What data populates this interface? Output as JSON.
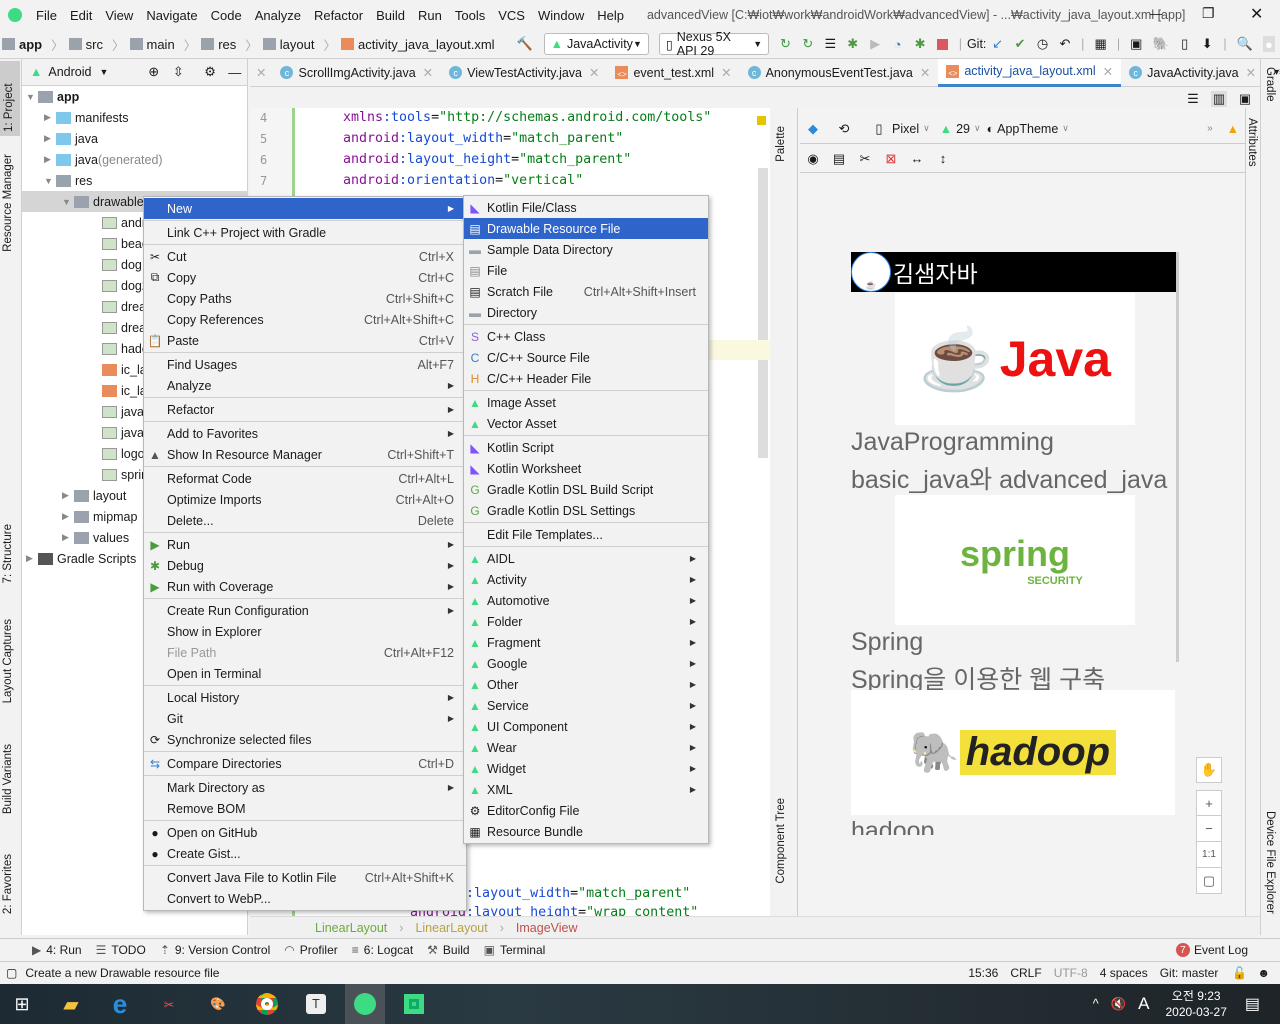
{
  "titlebar": {
    "menus": [
      "File",
      "Edit",
      "View",
      "Navigate",
      "Code",
      "Analyze",
      "Refactor",
      "Build",
      "Run",
      "Tools",
      "VCS",
      "Window",
      "Help"
    ],
    "title": "advancedView [C:₩iot₩work₩androidWork₩advancedView] - ...₩activity_java_layout.xml [app]"
  },
  "navbar": {
    "breadcrumb": [
      "app",
      "src",
      "main",
      "res",
      "layout",
      "activity_java_layout.xml"
    ],
    "run_config": "JavaActivity",
    "device": "Nexus 5X API 29",
    "git_label": "Git:"
  },
  "left_strip": {
    "project": "1: Project",
    "resource_manager": "Resource Manager",
    "structure": "7: Structure",
    "layout_captures": "Layout Captures",
    "build_variants": "Build Variants",
    "favorites": "2: Favorites"
  },
  "right_strip": {
    "gradle": "Gradle",
    "device_explorer": "Device File Explorer"
  },
  "project_panel": {
    "view_mode": "Android",
    "tree": [
      {
        "label": "app",
        "depth": 0,
        "open": true,
        "type": "module"
      },
      {
        "label": "manifests",
        "depth": 1,
        "type": "folder-blue"
      },
      {
        "label": "java",
        "depth": 1,
        "type": "folder-blue"
      },
      {
        "label": "java",
        "suffix": " (generated)",
        "depth": 1,
        "type": "folder-gen"
      },
      {
        "label": "res",
        "depth": 1,
        "open": true,
        "type": "folder-res"
      },
      {
        "label": "drawable",
        "depth": 2,
        "open": true,
        "type": "folder",
        "selected": true
      },
      {
        "label": "andro",
        "depth": 3,
        "type": "image"
      },
      {
        "label": "beach",
        "depth": 3,
        "type": "image"
      },
      {
        "label": "dog.j",
        "depth": 3,
        "type": "image"
      },
      {
        "label": "dog2",
        "depth": 3,
        "type": "image"
      },
      {
        "label": "drear",
        "depth": 3,
        "type": "image"
      },
      {
        "label": "drear",
        "depth": 3,
        "type": "image"
      },
      {
        "label": "hado",
        "depth": 3,
        "type": "image"
      },
      {
        "label": "ic_lau",
        "depth": 3,
        "type": "xml"
      },
      {
        "label": "ic_lau",
        "depth": 3,
        "type": "xml"
      },
      {
        "label": "java.p",
        "depth": 3,
        "type": "image"
      },
      {
        "label": "javaic",
        "depth": 3,
        "type": "image"
      },
      {
        "label": "logo.",
        "depth": 3,
        "type": "image"
      },
      {
        "label": "sprin",
        "depth": 3,
        "type": "image"
      },
      {
        "label": "layout",
        "depth": 2,
        "type": "folder"
      },
      {
        "label": "mipmap",
        "depth": 2,
        "type": "folder"
      },
      {
        "label": "values",
        "depth": 2,
        "type": "folder"
      },
      {
        "label": "Gradle Scripts",
        "depth": 0,
        "type": "gradle"
      }
    ]
  },
  "editor_tabs": [
    {
      "label": "ScrollImgActivity.java",
      "type": "class"
    },
    {
      "label": "ViewTestActivity.java",
      "type": "class"
    },
    {
      "label": "event_test.xml",
      "type": "xml"
    },
    {
      "label": "AnonymousEventTest.java",
      "type": "class"
    },
    {
      "label": "activity_java_layout.xml",
      "type": "xml",
      "active": true
    },
    {
      "label": "JavaActivity.java",
      "type": "class"
    }
  ],
  "tab_overflow": "3",
  "code": {
    "lines": [
      {
        "n": "4",
        "ns": "xmlns",
        "attr": ":tools",
        "val": "\"http://schemas.android.com/tools\""
      },
      {
        "n": "5",
        "ns": "android",
        "attr": ":layout_width",
        "val": "\"match_parent\""
      },
      {
        "n": "6",
        "ns": "android",
        "attr": ":layout_height",
        "val": "\"match_parent\""
      },
      {
        "n": "7",
        "ns": "android",
        "attr": ":orientation",
        "val": "\"vertical\""
      }
    ],
    "bottom_lines": [
      {
        "ns": "android",
        "attr": ":layout_width",
        "val": "\"match_parent\""
      },
      {
        "ns": "android",
        "attr": ":layout_height",
        "val": "\"wrap_content\""
      }
    ]
  },
  "design": {
    "palette": "Palette",
    "component_tree": "Component Tree",
    "attributes": "Attributes",
    "device": "Pixel",
    "api": "29",
    "theme": "AppTheme",
    "preview": {
      "app_title": "김샘자바",
      "items": [
        {
          "title": "JavaProgramming",
          "desc": "basic_java와 advanced_java",
          "logo": "Java"
        },
        {
          "title": "Spring",
          "desc": "Spring을 이용한 웹 구축",
          "logo": "spring",
          "logo_sub": "SECURITY"
        },
        {
          "title": "hadoop",
          "logo": "hadoop"
        }
      ]
    },
    "zoom": {
      "one_to_one": "1:1"
    }
  },
  "context_menu": [
    {
      "label": "New",
      "submenu": true,
      "highlight": true
    },
    "-",
    {
      "label": "Link C++ Project with Gradle"
    },
    "-",
    {
      "label": "Cut",
      "shortcut": "Ctrl+X",
      "icon": "cut"
    },
    {
      "label": "Copy",
      "shortcut": "Ctrl+C",
      "icon": "copy"
    },
    {
      "label": "Copy Paths",
      "shortcut": "Ctrl+Shift+C"
    },
    {
      "label": "Copy References",
      "shortcut": "Ctrl+Alt+Shift+C"
    },
    {
      "label": "Paste",
      "shortcut": "Ctrl+V",
      "icon": "paste"
    },
    "-",
    {
      "label": "Find Usages",
      "shortcut": "Alt+F7"
    },
    {
      "label": "Analyze",
      "submenu": true
    },
    "-",
    {
      "label": "Refactor",
      "submenu": true
    },
    "-",
    {
      "label": "Add to Favorites",
      "submenu": true
    },
    {
      "label": "Show In Resource Manager",
      "shortcut": "Ctrl+Shift+T",
      "icon": "resource"
    },
    "-",
    {
      "label": "Reformat Code",
      "shortcut": "Ctrl+Alt+L"
    },
    {
      "label": "Optimize Imports",
      "shortcut": "Ctrl+Alt+O"
    },
    {
      "label": "Delete...",
      "shortcut": "Delete"
    },
    "-",
    {
      "label": "Run",
      "submenu": true,
      "icon": "run"
    },
    {
      "label": "Debug",
      "submenu": true,
      "icon": "debug"
    },
    {
      "label": "Run with Coverage",
      "submenu": true,
      "icon": "coverage"
    },
    "-",
    {
      "label": "Create Run Configuration",
      "submenu": true
    },
    {
      "label": "Show in Explorer"
    },
    {
      "label": "File Path",
      "shortcut": "Ctrl+Alt+F12",
      "disabled": true
    },
    {
      "label": "Open in Terminal"
    },
    "-",
    {
      "label": "Local History",
      "submenu": true
    },
    {
      "label": "Git",
      "submenu": true
    },
    {
      "label": "Synchronize selected files",
      "icon": "sync"
    },
    "-",
    {
      "label": "Compare Directories",
      "shortcut": "Ctrl+D",
      "icon": "compare"
    },
    "-",
    {
      "label": "Mark Directory as",
      "submenu": true
    },
    {
      "label": "Remove BOM"
    },
    "-",
    {
      "label": "Open on GitHub",
      "icon": "github"
    },
    {
      "label": "Create Gist...",
      "icon": "github"
    },
    "-",
    {
      "label": "Convert Java File to Kotlin File",
      "shortcut": "Ctrl+Alt+Shift+K"
    },
    {
      "label": "Convert to WebP..."
    }
  ],
  "new_submenu": [
    {
      "label": "Kotlin File/Class",
      "icon": "kotlin"
    },
    {
      "label": "Drawable Resource File",
      "icon": "file",
      "highlight": true
    },
    {
      "label": "Sample Data Directory",
      "icon": "folder"
    },
    {
      "label": "File",
      "icon": "file"
    },
    {
      "label": "Scratch File",
      "shortcut": "Ctrl+Alt+Shift+Insert",
      "icon": "scratch"
    },
    {
      "label": "Directory",
      "icon": "folder"
    },
    "-",
    {
      "label": "C++ Class",
      "icon": "cpp-class"
    },
    {
      "label": "C/C++ Source File",
      "icon": "cpp-source"
    },
    {
      "label": "C/C++ Header File",
      "icon": "cpp-header"
    },
    "-",
    {
      "label": "Image Asset",
      "icon": "android"
    },
    {
      "label": "Vector Asset",
      "icon": "android"
    },
    "-",
    {
      "label": "Kotlin Script",
      "icon": "kotlin"
    },
    {
      "label": "Kotlin Worksheet",
      "icon": "kotlin"
    },
    {
      "label": "Gradle Kotlin DSL Build Script",
      "icon": "gradle"
    },
    {
      "label": "Gradle Kotlin DSL Settings",
      "icon": "gradle"
    },
    "-",
    {
      "label": "Edit File Templates..."
    },
    "-",
    {
      "label": "AIDL",
      "submenu": true,
      "icon": "android"
    },
    {
      "label": "Activity",
      "submenu": true,
      "icon": "android"
    },
    {
      "label": "Automotive",
      "submenu": true,
      "icon": "android"
    },
    {
      "label": "Folder",
      "submenu": true,
      "icon": "android"
    },
    {
      "label": "Fragment",
      "submenu": true,
      "icon": "android"
    },
    {
      "label": "Google",
      "submenu": true,
      "icon": "android"
    },
    {
      "label": "Other",
      "submenu": true,
      "icon": "android"
    },
    {
      "label": "Service",
      "submenu": true,
      "icon": "android"
    },
    {
      "label": "UI Component",
      "submenu": true,
      "icon": "android"
    },
    {
      "label": "Wear",
      "submenu": true,
      "icon": "android"
    },
    {
      "label": "Widget",
      "submenu": true,
      "icon": "android"
    },
    {
      "label": "XML",
      "submenu": true,
      "icon": "android"
    },
    {
      "label": "EditorConfig File",
      "icon": "gear"
    },
    {
      "label": "Resource Bundle",
      "icon": "bundle"
    }
  ],
  "breadcrumb_bottom": [
    {
      "label": "LinearLayout",
      "color": "#6aab3e"
    },
    {
      "label": "LinearLayout",
      "color": "#b5a244"
    },
    {
      "label": "ImageView",
      "color": "#c0504d"
    }
  ],
  "tool_windows": [
    {
      "label": "4: Run",
      "icon": "run"
    },
    {
      "label": "TODO",
      "icon": "list"
    },
    {
      "label": "9: Version Control",
      "icon": "vcs"
    },
    {
      "label": "Profiler",
      "icon": "gauge"
    },
    {
      "label": "6: Logcat",
      "icon": "logcat"
    },
    {
      "label": "Build",
      "icon": "hammer"
    },
    {
      "label": "Terminal",
      "icon": "terminal"
    }
  ],
  "event_log": {
    "count": "7",
    "label": "Event Log"
  },
  "status": {
    "message": "Create a new Drawable resource file",
    "position": "15:36",
    "line_sep": "CRLF",
    "encoding": "UTF-8",
    "indent": "4 spaces",
    "branch": "Git: master"
  },
  "taskbar": {
    "time": "오전 9:23",
    "date": "2020-03-27",
    "ime": "A"
  },
  "colors": {
    "menu_highlight": "#2f65ca",
    "active_tab": "#4083c9",
    "android_green": "#3ddc84"
  }
}
